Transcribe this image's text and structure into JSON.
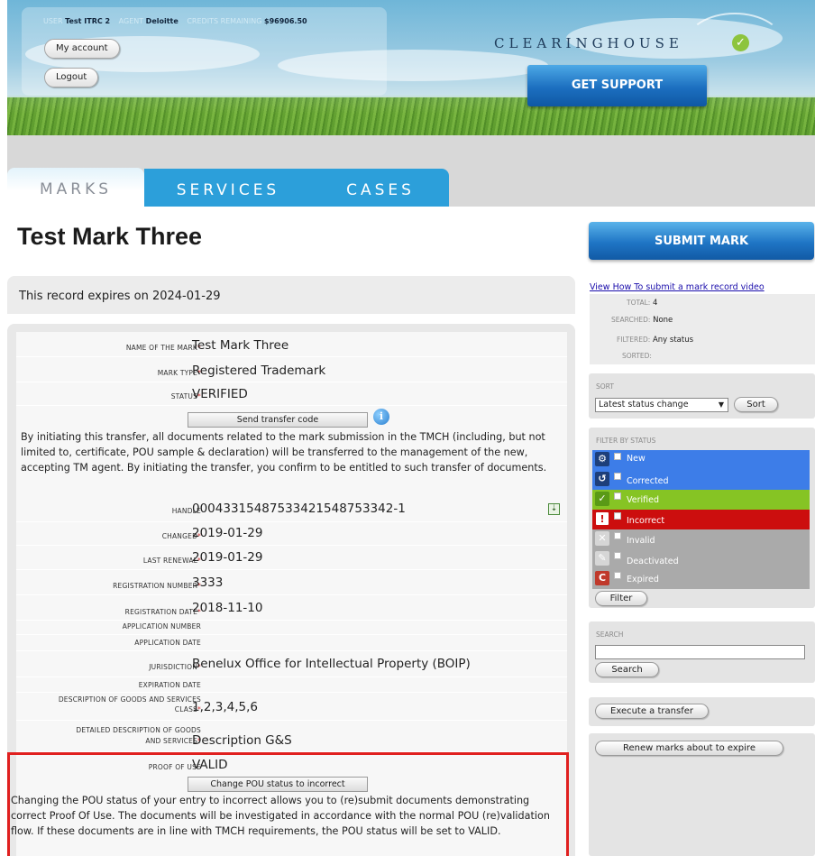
{
  "header": {
    "user_label": "USER",
    "user": "Test ITRC 2",
    "agent_label": "AGENT",
    "agent": "Deloitte",
    "credits_label": "CREDITS REMAINING",
    "credits": "$96906.50",
    "my_account": "My account",
    "logout": "Logout",
    "logo": "CLEARINGHOUSE",
    "support": "GET SUPPORT"
  },
  "tabs": [
    "MARKS",
    "SERVICES",
    "CASES"
  ],
  "page": {
    "title": "Test Mark Three",
    "expiry": "This record expires on 2024-01-29"
  },
  "fields": {
    "name_label": "Name of the mark",
    "name": "Test Mark Three",
    "type_label": "Mark type",
    "type": "Registered Trademark",
    "status_label": "Status",
    "status": "VERIFIED",
    "send_transfer": "Send transfer code",
    "transfer_text": "By initiating this transfer, all documents related to the mark submission in the TMCH (including, but not limited to, certificate, POU sample & declaration) will be transferred to the management of the new, accepting TM agent. By initiating the transfer, you confirm to be entitled to such transfer of documents.",
    "handle_label": "Handle",
    "handle": "00043315487533421548753342-1",
    "changed_label": "Changed",
    "changed": "2019-01-29",
    "renewal_label": "Last renewal",
    "renewal": "2019-01-29",
    "regnum_label": "Registration number",
    "regnum": "3333",
    "regdate_label": "Registration date",
    "regdate": "2018-11-10",
    "appnum_label": "Application number",
    "appdate_label": "Application date",
    "jurisdiction_label": "Jurisdiction",
    "jurisdiction": "Benelux Office for Intellectual Property (BOIP)",
    "expdate_label": "Expiration date",
    "class_label_1": "Description of goods and services",
    "class_label_2": "Class",
    "class": "1,2,3,4,5,6",
    "gs_label_1": "Detailed description of goods",
    "gs_label_2": "and services",
    "gs": "Description G&S",
    "pou_label": "Proof of use",
    "pou": "VALID",
    "change_pou": "Change POU status to incorrect",
    "pou_text": "Changing the POU status of your entry to incorrect allows you to (re)submit documents demonstrating correct Proof Of Use. The documents will be investigated in accordance with the normal POU (re)validation flow. If these documents are in line with TMCH requirements, the POU status will be set to VALID."
  },
  "sidebar": {
    "submit": "SUBMIT MARK",
    "video_link": "View How To submit a mark record video",
    "total_label": "TOTAL:",
    "total": "4",
    "searched_label": "SEARCHED:",
    "searched": "None",
    "filtered_label": "FILTERED:",
    "filtered": "Any status",
    "sorted_label": "SORTED:",
    "sort_title": "SORT",
    "sort_value": "Latest status change",
    "sort_button": "Sort",
    "filter_title": "FILTER BY STATUS",
    "statuses": [
      "New",
      "Corrected",
      "Verified",
      "Incorrect",
      "Invalid",
      "Deactivated",
      "Expired"
    ],
    "filter_button": "Filter",
    "search_title": "SEARCH",
    "search_button": "Search",
    "transfer_button": "Execute a transfer",
    "renew_button": "Renew marks about to expire"
  },
  "colors": {
    "tab_blue": "#2c9fda",
    "new": "#3d7de8",
    "corrected": "#3d7de8",
    "verified": "#86c424",
    "incorrect": "#cc0e0e",
    "inactive": "#aaaaaa",
    "highlight": "#e0201f"
  },
  "icons": [
    "settings-icon",
    "refresh-icon",
    "check-icon",
    "warning-icon",
    "close-icon",
    "pencil-icon",
    "expired-icon",
    "info-icon",
    "download-icon"
  ]
}
